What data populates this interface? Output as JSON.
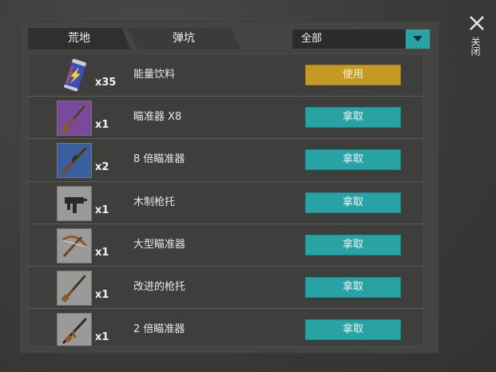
{
  "tabs": [
    {
      "label": "荒地"
    },
    {
      "label": "弹坑"
    }
  ],
  "filter": {
    "selected": "全部"
  },
  "close_label": "关闭",
  "items": [
    {
      "name": "能量饮料",
      "count": "x35",
      "action": "使用",
      "icon": "energy-drink-icon",
      "frame": "none"
    },
    {
      "name": "瞄准器 X8",
      "count": "x1",
      "action": "拿取",
      "icon": "shotgun-icon",
      "frame": "purple"
    },
    {
      "name": "8 倍瞄准器",
      "count": "x2",
      "action": "拿取",
      "icon": "rifle-icon",
      "frame": "blue"
    },
    {
      "name": "木制枪托",
      "count": "x1",
      "action": "拿取",
      "icon": "smg-icon",
      "frame": "gray"
    },
    {
      "name": "大型瞄准器",
      "count": "x1",
      "action": "拿取",
      "icon": "crossbow-icon",
      "frame": "gray"
    },
    {
      "name": "改进的枪托",
      "count": "x1",
      "action": "拿取",
      "icon": "shotgun-icon",
      "frame": "gray"
    },
    {
      "name": "2 倍瞄准器",
      "count": "x1",
      "action": "拿取",
      "icon": "assault-rifle-icon",
      "frame": "gray"
    }
  ],
  "colors": {
    "take_button": "#28a3a5",
    "use_button": "#c49a25",
    "frame_purple": "#7a4a9a",
    "frame_blue": "#3a5f9e",
    "frame_gray": "#9a9a98"
  }
}
